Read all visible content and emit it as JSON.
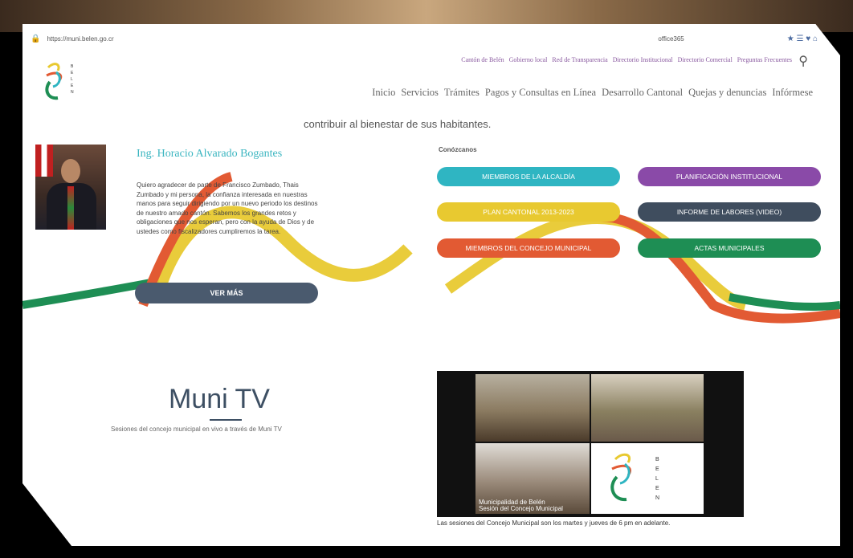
{
  "browser": {
    "url": "https://muni.belen.go.cr",
    "search": "office365"
  },
  "header": {
    "top_links": [
      "Cantón de Belén",
      "Gobierno local",
      "Red de Transparencia",
      "Directorio Institucional",
      "Directorio Comercial",
      "Preguntas Frecuentes"
    ],
    "nav": [
      "Inicio",
      "Servicios",
      "Trámites",
      "Pagos y Consultas en Línea",
      "Desarrollo Cantonal",
      "Quejas y denuncias",
      "Infórmese"
    ]
  },
  "intro_text": "contribuir al bienestar de sus habitantes.",
  "mayor": {
    "name": "Ing. Horacio Alvarado Bogantes",
    "bio": "Quiero agradecer de parte de Francisco Zumbado, Thais Zumbado y mi persona, la confianza interesada en nuestras manos para seguir dirigiendo por un nuevo periodo los destinos de nuestro amado cantón. Sabemos los grandes retos y obligaciones que nos esperan, pero con la ayuda de Dios y de ustedes como fiscalizadores cumpliremos la tarea.",
    "button": "VER MÁS"
  },
  "links_section": {
    "label": "Conózcanos",
    "buttons": [
      {
        "label": "MIEMBROS DE LA ALCALDÍA",
        "color": "#2fb5c2"
      },
      {
        "label": "PLANIFICACIÓN INSTITUCIONAL",
        "color": "#8a4aa8"
      },
      {
        "label": "PLAN CANTONAL 2013-2023",
        "color": "#e8c930"
      },
      {
        "label": "INFORME DE LABORES (VIDEO)",
        "color": "#3f4d5e"
      },
      {
        "label": "MIEMBROS DEL CONCEJO MUNICIPAL",
        "color": "#e25a33"
      },
      {
        "label": "ACTAS MUNICIPALES",
        "color": "#1e8e54"
      }
    ]
  },
  "munitv": {
    "title": "Muni TV",
    "subtitle": "Sesiones del concejo municipal en vivo a través de Muni TV",
    "video_caption_1": "Municipalidad de Belén",
    "video_caption_2": "Sesión del Concejo Municipal",
    "footer": "Las sesiones del Concejo Municipal son los martes y jueves de 6 pm en adelante."
  },
  "colors": {
    "teal": "#2fb5c2",
    "orange": "#e25a33",
    "yellow": "#e8c930",
    "green": "#1e8e54",
    "slate": "#3f4d5e",
    "purple": "#8a4aa8"
  }
}
